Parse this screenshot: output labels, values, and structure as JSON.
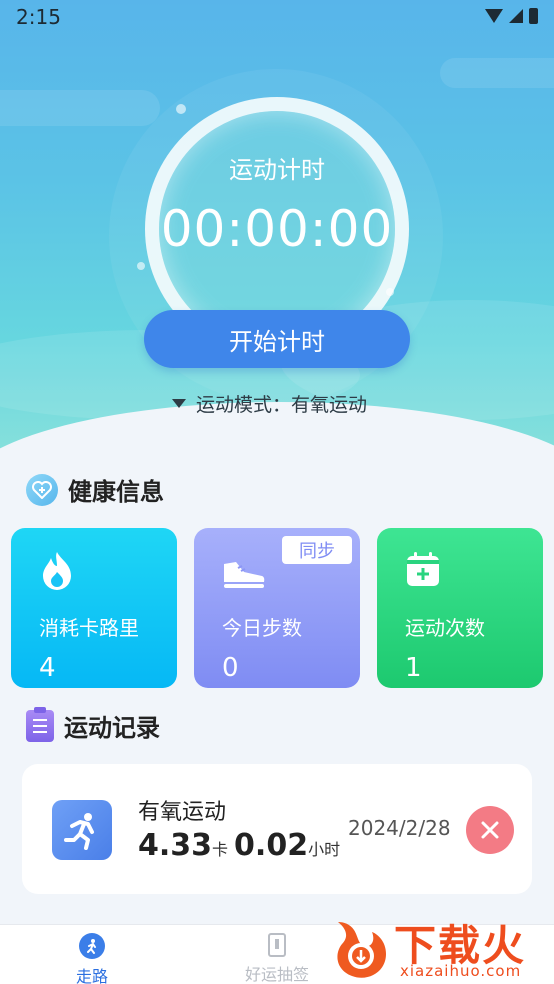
{
  "status_bar": {
    "time": "2:15"
  },
  "timer": {
    "label": "运动计时",
    "value": "00:00:00",
    "start_button": "开始计时",
    "mode_text": "运动模式：有氧运动"
  },
  "health": {
    "title": "健康信息",
    "cards": [
      {
        "label": "消耗卡路里",
        "value": "4",
        "icon": "flame-icon"
      },
      {
        "label": "今日步数",
        "value": "0",
        "icon": "shoe-icon",
        "badge": "同步"
      },
      {
        "label": "运动次数",
        "value": "1",
        "icon": "calendar-add-icon"
      }
    ]
  },
  "records": {
    "title": "运动记录",
    "items": [
      {
        "title": "有氧运动",
        "calories": "4.33",
        "calories_unit": "卡",
        "hours": "0.02",
        "hours_unit": "小时",
        "date": "2024/2/28"
      }
    ]
  },
  "bottom_nav": {
    "items": [
      {
        "label": "走路",
        "icon": "walk-icon",
        "active": true
      },
      {
        "label": "好运抽签",
        "icon": "lottery-icon",
        "active": false
      }
    ]
  },
  "watermark": {
    "text": "下载火",
    "sub": "xiazaihuo.com"
  },
  "colors": {
    "accent": "#3f86ea",
    "calorie_card": "#06b8f5",
    "steps_card": "#7f8cf3",
    "count_card": "#1dc96f",
    "delete": "#f37b85"
  }
}
